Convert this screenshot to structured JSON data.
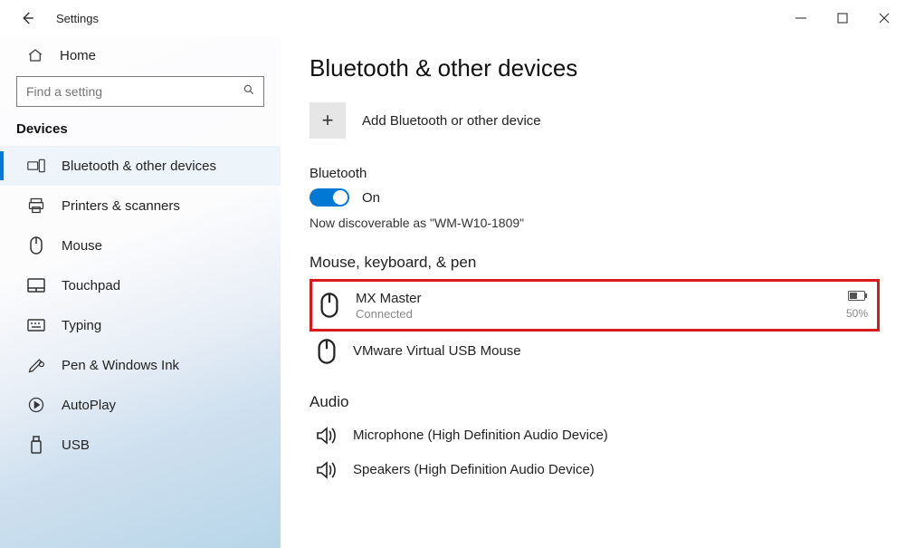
{
  "window": {
    "title": "Settings"
  },
  "sidebar": {
    "home": "Home",
    "search_placeholder": "Find a setting",
    "section": "Devices",
    "items": [
      {
        "label": "Bluetooth & other devices",
        "icon": "devices"
      },
      {
        "label": "Printers & scanners",
        "icon": "printer"
      },
      {
        "label": "Mouse",
        "icon": "mouse"
      },
      {
        "label": "Touchpad",
        "icon": "touchpad"
      },
      {
        "label": "Typing",
        "icon": "keyboard"
      },
      {
        "label": "Pen & Windows Ink",
        "icon": "pen"
      },
      {
        "label": "AutoPlay",
        "icon": "autoplay"
      },
      {
        "label": "USB",
        "icon": "usb"
      }
    ]
  },
  "main": {
    "title": "Bluetooth & other devices",
    "add_label": "Add Bluetooth or other device",
    "bt_header": "Bluetooth",
    "bt_state": "On",
    "discover_text": "Now discoverable as \"WM-W10-1809\"",
    "mouse_section": "Mouse, keyboard, & pen",
    "devices": {
      "mx": {
        "name": "MX Master",
        "status": "Connected",
        "battery": "50%"
      },
      "vm": {
        "name": "VMware Virtual USB Mouse"
      }
    },
    "audio_section": "Audio",
    "audio": {
      "mic": "Microphone (High Definition Audio Device)",
      "spk": "Speakers (High Definition Audio Device)"
    }
  }
}
